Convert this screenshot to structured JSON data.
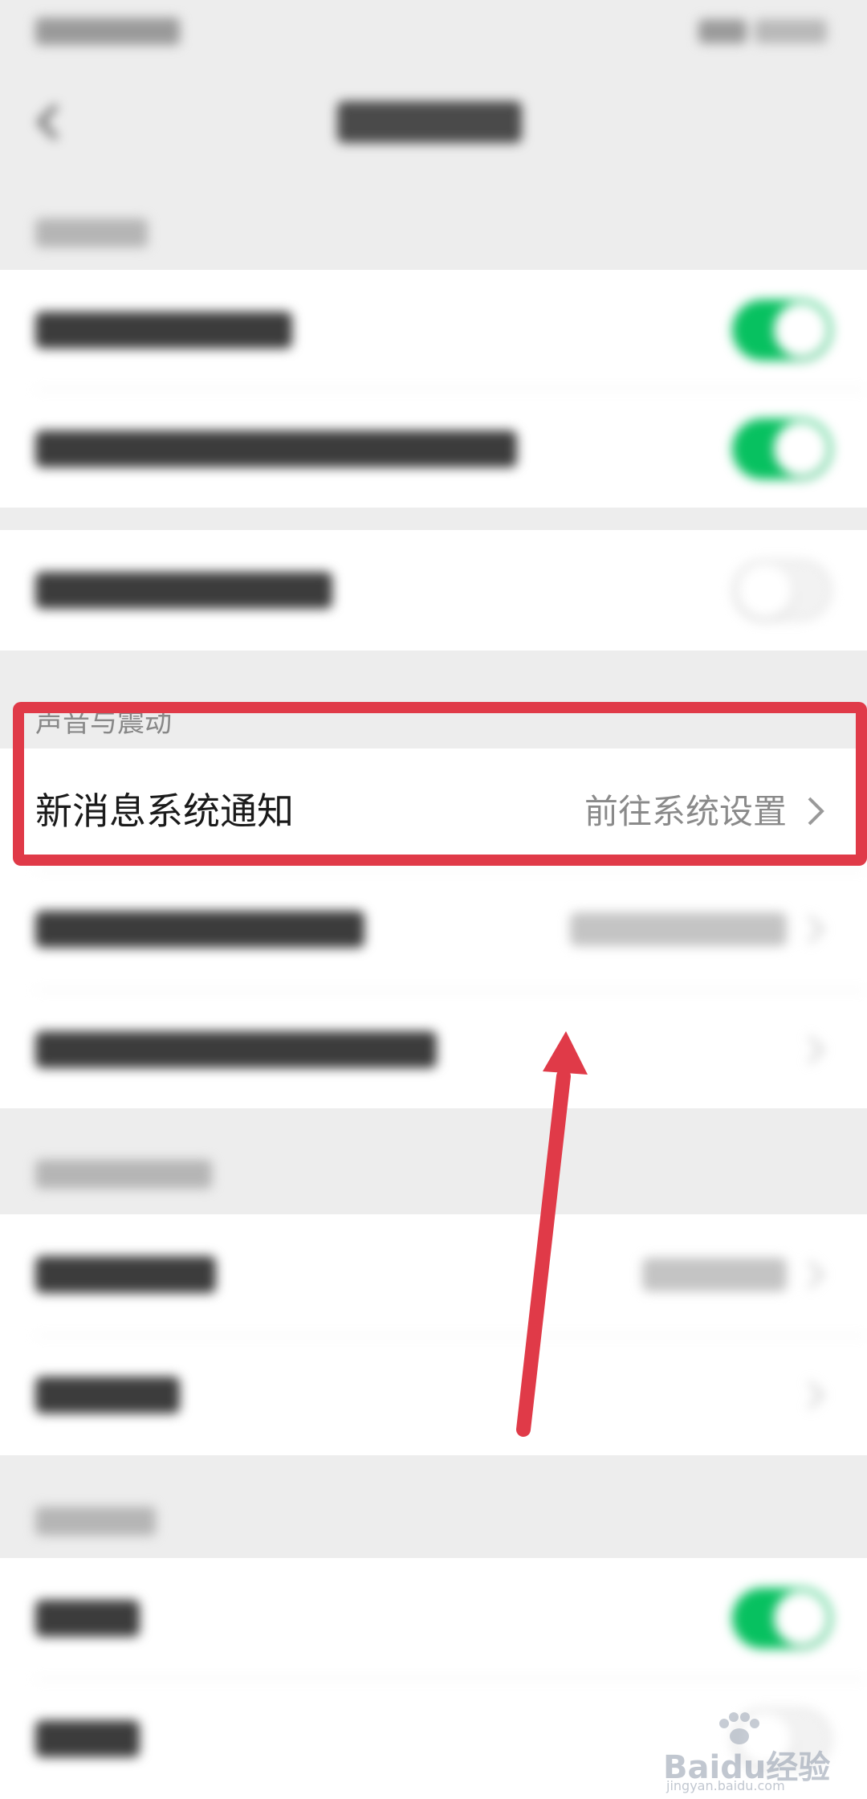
{
  "status_bar": {
    "left_text": "",
    "right_text": ""
  },
  "nav": {
    "title": ""
  },
  "section_1": {
    "label": "",
    "rows": [
      {
        "title": "",
        "toggle": "on"
      },
      {
        "title": "",
        "toggle": "on"
      }
    ]
  },
  "standalone_row": {
    "title": "",
    "toggle": "off"
  },
  "sound_section": {
    "label": "声音与震动",
    "rows": [
      {
        "title": "新消息系统通知",
        "value": "前往系统设置"
      },
      {
        "title": "",
        "value": ""
      },
      {
        "title": "",
        "value": ""
      }
    ]
  },
  "section_3": {
    "label": "",
    "rows": [
      {
        "title": "",
        "value": ""
      },
      {
        "title": "",
        "value": ""
      }
    ]
  },
  "section_4": {
    "label": "",
    "rows": [
      {
        "title": "",
        "toggle": "on"
      },
      {
        "title": "",
        "toggle": "off"
      }
    ]
  },
  "watermark": {
    "text": "Baidu经验",
    "subtext": "jingyan.baidu.com"
  },
  "annotation": {
    "highlight_color": "#e03a48",
    "arrow_color": "#e03a48"
  }
}
